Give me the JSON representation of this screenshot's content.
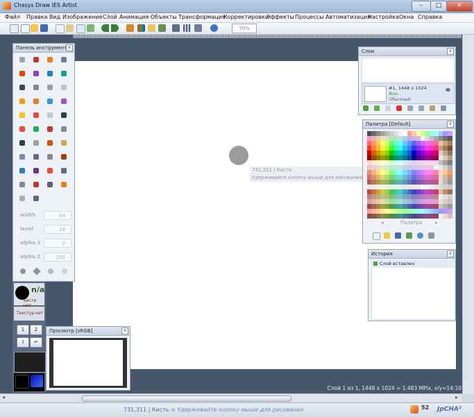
{
  "window": {
    "title": "Chasys Draw IES Artist",
    "controls": {
      "minimize": "–",
      "maximize": "□",
      "close": "✕"
    }
  },
  "menu": [
    "Файл",
    "Правка",
    "Вид",
    "Изображение",
    "Слой",
    "Анимация",
    "Объекты",
    "Трансформация",
    "Корректировки",
    "Эффекты",
    "Процессы",
    "Автоматизация",
    "Настройка",
    "Окна",
    "Справка"
  ],
  "toolbar": {
    "zoom_value": "70%",
    "icons": [
      "new-doc-icon",
      "open-icon",
      "open-folder-icon",
      "save-icon",
      "copy-icon",
      "paste-icon",
      "duplicate-icon",
      "export-icon",
      "back-arrow-icon",
      "forward-arrow-icon",
      "wand-icon",
      "layers-icon",
      "image-icon",
      "frame-icon",
      "crop-icon",
      "grid-icon",
      "fullscreen-icon",
      "help-icon"
    ]
  },
  "tools_panel": {
    "title": "Панель инструментов",
    "close": "x",
    "tool_icons": [
      "move-icon",
      "pencil-icon",
      "brush-icon",
      "eyedropper-icon",
      "spray-icon",
      "eraser-icon",
      "fill-icon",
      "smudge-icon",
      "line-brush-icon",
      "blur-icon",
      "sharpen-icon",
      "pattern-icon",
      "dodge-icon",
      "burn-icon",
      "liquid-icon",
      "stamp-icon",
      "text-marker-icon",
      "horseshoe-icon",
      "shape-icon",
      "undo-arrow-icon",
      "magic-icon",
      "redo-icon",
      "lasso-icon",
      "select-icon",
      "zoom-icon",
      "clone-icon",
      "gradient-icon",
      "bucket-icon",
      "rect-select-icon",
      "text-icon",
      "crop-icon",
      "chart-icon",
      "line-icon",
      "curve-icon",
      "shapes-icon",
      "frame-tool-icon",
      "rotate-icon",
      "hand-icon",
      "cube-icon",
      "color-swatch-icon",
      "layer-tool-icon",
      "macro-icon"
    ],
    "params": [
      {
        "label": "width",
        "value": "64"
      },
      {
        "label": "level",
        "value": "16"
      },
      {
        "label": "alpha.1",
        "value": "0"
      },
      {
        "label": "alpha.2",
        "value": "255"
      }
    ]
  },
  "brush_box": {
    "na": "n/a",
    "brush_label": "кисти нет"
  },
  "texture_box": {
    "label": "Текстур нет"
  },
  "mode_buttons": [
    "1",
    "2",
    "⇧",
    "↵"
  ],
  "preview_panel": {
    "title": "Просмотр [sRGB]",
    "close": "x"
  },
  "layers_panel": {
    "title": "Слои",
    "close": "x",
    "layer": {
      "name": "#1, 1448 x 1024",
      "type": "Фон",
      "blend": "Обычный"
    }
  },
  "palette_panel": {
    "title": "Палитра [Default]",
    "close": "x",
    "nav_label": "Палитра",
    "prev": "◂",
    "next": "▸",
    "colors": [
      "#4d4d4d",
      "#6a6a6a",
      "#878787",
      "#a1a1a1",
      "#b8b8b8",
      "#cdcdcd",
      "#e0e0e0",
      "#f0f0f0",
      "#ffffff",
      "#ff9999",
      "#ffcc99",
      "#ffff99",
      "#ccff99",
      "#99ff99",
      "#99ffcc",
      "#99ffff",
      "#99ccff",
      "#9999ff",
      "#cc99ff",
      "#ff99cc",
      "#e6b3b3",
      "#e6ccb3",
      "#e6e6b3",
      "#cce6b3",
      "#b3e6b3",
      "#b3e6cc",
      "#b3e6e6",
      "#b3cce6",
      "#b3b3e6",
      "#ccb3e6",
      "#e6b3cc",
      "#f2f2f2",
      "#d9d9d9",
      "#bfbfbf",
      "#a6a6a6",
      "#8c8c8c",
      "#737373",
      "#595959",
      "#ff6666",
      "#ff9966",
      "#ffcc66",
      "#ffff66",
      "#ccff66",
      "#66ff66",
      "#66ffcc",
      "#66ffff",
      "#66ccff",
      "#6699ff",
      "#6666ff",
      "#9966ff",
      "#cc66ff",
      "#ff66ff",
      "#ff66cc",
      "#ff6699",
      "#e8c9a0",
      "#d4a574",
      "#b08050",
      "#ff3333",
      "#ff8033",
      "#ffb333",
      "#ffee33",
      "#b3ff33",
      "#33ff33",
      "#33ffaa",
      "#33ffee",
      "#33b3ff",
      "#3380ff",
      "#3333ff",
      "#8033ff",
      "#b333ff",
      "#ff33ff",
      "#ff33b3",
      "#ff3380",
      "#c8a07a",
      "#a0785a",
      "#785038",
      "#cc0000",
      "#cc6600",
      "#cc9900",
      "#cccc00",
      "#99cc00",
      "#00cc00",
      "#00cc99",
      "#00cccc",
      "#0099cc",
      "#0066cc",
      "#0000cc",
      "#6600cc",
      "#9900cc",
      "#cc00cc",
      "#cc0099",
      "#cc0066",
      "#e0d0c0",
      "#c0a890",
      "#907860",
      "#990000",
      "#994c00",
      "#997300",
      "#999900",
      "#739900",
      "#009900",
      "#009973",
      "#009999",
      "#007399",
      "#004c99",
      "#000099",
      "#4c0099",
      "#730099",
      "#990099",
      "#990073",
      "#99004c",
      "#f0e6dc",
      "#d8c8b8",
      "#b8a088",
      "#ffd5d5",
      "#ffe6d5",
      "#fff2d5",
      "#ffffd5",
      "#eaffd5",
      "#d5ffd5",
      "#d5ffea",
      "#d5ffff",
      "#d5eaff",
      "#d5e0ff",
      "#d5d5ff",
      "#e6d5ff",
      "#f2d5ff",
      "#ffd5ff",
      "#ffd5f2",
      "#ffd5e6",
      "#c0c0c0",
      "#a0a0a0",
      "#808080",
      "#e6c8c8",
      "#e6d2c8",
      "#e6dcc8",
      "#e6e6c8",
      "#d2e6c8",
      "#c8e6c8",
      "#c8e6d2",
      "#c8e6e6",
      "#c8d2e6",
      "#c8c8e6",
      "#d2c8e6",
      "#dcc8e6",
      "#e6c8e6",
      "#e6c8dc",
      "#e6c8d2",
      "#f5f5f5",
      "#e8e8e8",
      "#d0d0d0",
      "#b0b0b0",
      "#ff8080",
      "#ffb380",
      "#ffd980",
      "#ffff80",
      "#d9ff80",
      "#80ff80",
      "#80ffd9",
      "#80ffff",
      "#80d9ff",
      "#80b3ff",
      "#8080ff",
      "#b380ff",
      "#d980ff",
      "#ff80ff",
      "#ff80d9",
      "#ff80b3",
      "#ffe0b0",
      "#ffc890",
      "#f0a070",
      "#d97070",
      "#d99970",
      "#d9b870",
      "#d9d970",
      "#b8d970",
      "#70d970",
      "#70d9b8",
      "#70d9d9",
      "#70b8d9",
      "#7099d9",
      "#7070d9",
      "#9970d9",
      "#b870d9",
      "#d970d9",
      "#d970b8",
      "#d97099",
      "#e8d8c8",
      "#d0b8a0",
      "#b89878",
      "#b35959",
      "#b37a59",
      "#b39959",
      "#b3b359",
      "#99b359",
      "#59b359",
      "#59b399",
      "#59b3b3",
      "#5999b3",
      "#597ab3",
      "#5959b3",
      "#7a59b3",
      "#9959b3",
      "#b359b3",
      "#b35999",
      "#b3597a",
      "#dddddd",
      "#bbbbbb",
      "#999999",
      "#f2e6e6",
      "#f2ece6",
      "#f2f2e6",
      "#ecf2e6",
      "#e6f2e6",
      "#e6f2ec",
      "#e6f2f2",
      "#e6ecf2",
      "#e6e6f2",
      "#ece6f2",
      "#f2e6f2",
      "#f2e6ec",
      "#ffffff",
      "#f8f8f8",
      "#eeeeee",
      "#e4e4e4",
      "#dadada",
      "#d0d0d0",
      "#c6c6c6",
      "#cc4040",
      "#cc7040",
      "#cca040",
      "#cccc40",
      "#a0cc40",
      "#40cc40",
      "#40cca0",
      "#40cccc",
      "#40a0cc",
      "#4070cc",
      "#4040cc",
      "#7040cc",
      "#a040cc",
      "#cc40cc",
      "#cc40a0",
      "#cc4070",
      "#e0c0a0",
      "#c09070",
      "#a07050",
      "#c08080",
      "#c09880",
      "#c0b080",
      "#c0c080",
      "#a8c080",
      "#80c080",
      "#80c0a8",
      "#80c0c0",
      "#80a8c0",
      "#8098c0",
      "#8080c0",
      "#9880c0",
      "#b080c0",
      "#c080c0",
      "#c080b0",
      "#c08098",
      "#f0f0f0",
      "#e0e0e0",
      "#d0d0d0",
      "#e0a0a0",
      "#e0b8a0",
      "#e0d0a0",
      "#e0e0a0",
      "#c8e0a0",
      "#a0e0a0",
      "#a0e0c8",
      "#a0e0e0",
      "#a0c8e0",
      "#a0b8e0",
      "#a0a0e0",
      "#b8a0e0",
      "#d0a0e0",
      "#e0a0e0",
      "#e0a0d0",
      "#e0a0b8",
      "#e8e0d8",
      "#d8d0c8",
      "#c8c0b8",
      "#a04848",
      "#a06848",
      "#a08848",
      "#a0a048",
      "#88a048",
      "#48a048",
      "#48a088",
      "#48a0a0",
      "#4888a0",
      "#4868a0",
      "#4848a0",
      "#6848a0",
      "#8848a0",
      "#a048a0",
      "#a04888",
      "#a04868",
      "#c8c8c8",
      "#b0b0b0",
      "#989898",
      "#ff9999",
      "#ffb399",
      "#ffcc99",
      "#ffe699",
      "#ffff99",
      "#e6ff99",
      "#ccff99",
      "#b3ff99",
      "#99ff99",
      "#99ffb3",
      "#99ffcc",
      "#99ffe6",
      "#99ffff",
      "#99e6ff",
      "#99ccff",
      "#99b3ff",
      "#9999ff",
      "#b399ff",
      "#cc99ff",
      "#8c4a4a",
      "#8c5e4a",
      "#8c734a",
      "#8c8c4a",
      "#738c4a",
      "#4a8c4a",
      "#4a8c73",
      "#4a8c8c",
      "#4a738c",
      "#4a5e8c",
      "#4a4a8c",
      "#5e4a8c",
      "#734a8c",
      "#8c4a8c",
      "#8c4a73",
      "#8c4a5e",
      "#f8f0e8",
      "#e8d8c8",
      "#d8c0a8"
    ]
  },
  "history_panel": {
    "title": "История",
    "close": "x",
    "items": [
      "Слой вставлен"
    ]
  },
  "canvas": {
    "cursor_tip_coords": "731,311 | Кисть",
    "cursor_tip_hint": "Удерживайте кнопку мыши для рисования"
  },
  "canvas_status": "Слой 1 из 1, 1448 x 1024 = 1.483 MPix, x/y=14:10",
  "statusbar": {
    "coords": "731,311 | Кисть",
    "separator": " = ",
    "hint": "Удерживайте кнопку мыши для рисования",
    "count": "52",
    "brand": "JpCHA²"
  }
}
